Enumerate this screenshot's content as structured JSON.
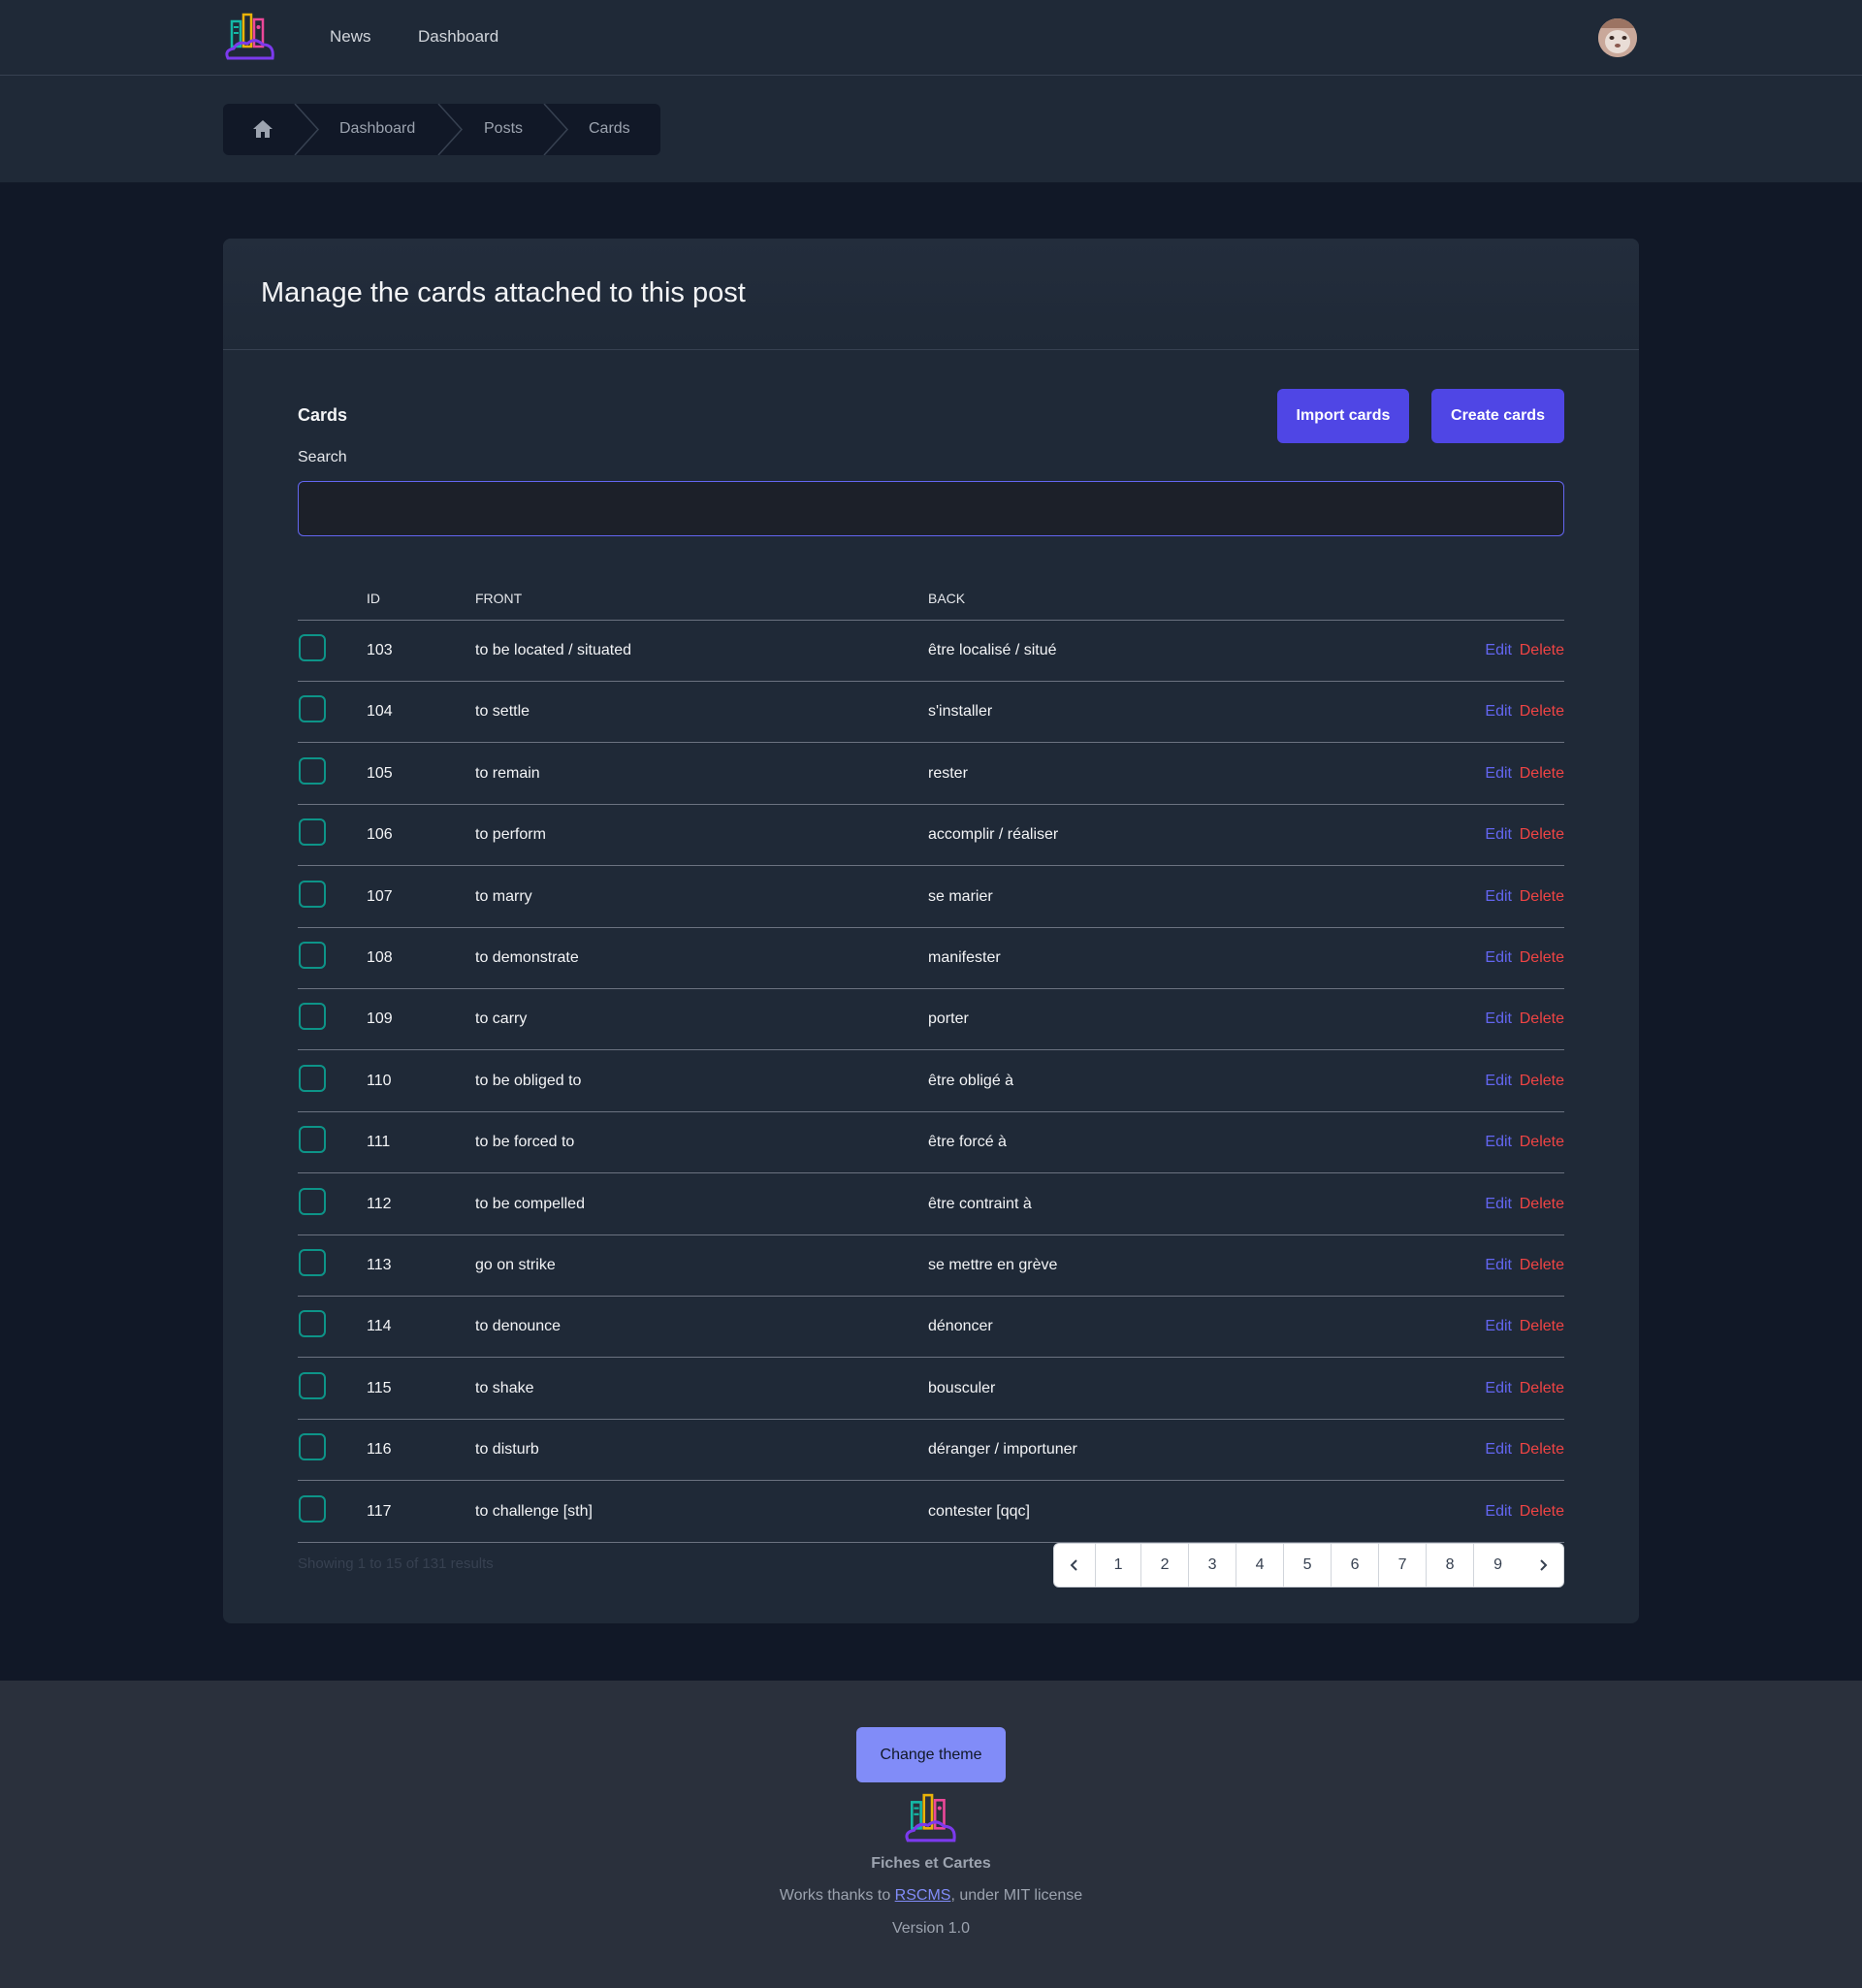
{
  "nav": {
    "links": [
      "News",
      "Dashboard"
    ]
  },
  "breadcrumb": {
    "items": [
      "Dashboard",
      "Posts",
      "Cards"
    ]
  },
  "page": {
    "title": "Manage the cards attached to this post",
    "section_title": "Cards",
    "search_label": "Search",
    "search_value": "",
    "import_label": "Import cards",
    "create_label": "Create cards"
  },
  "table": {
    "headers": [
      "ID",
      "Front",
      "Back"
    ],
    "edit_label": "Edit",
    "delete_label": "Delete",
    "rows": [
      {
        "id": "103",
        "front": "to be located / situated",
        "back": "être localisé / situé"
      },
      {
        "id": "104",
        "front": "to settle",
        "back": "s'installer"
      },
      {
        "id": "105",
        "front": "to remain",
        "back": "rester"
      },
      {
        "id": "106",
        "front": "to perform",
        "back": "accomplir / réaliser"
      },
      {
        "id": "107",
        "front": "to marry",
        "back": "se marier"
      },
      {
        "id": "108",
        "front": "to demonstrate",
        "back": "manifester"
      },
      {
        "id": "109",
        "front": "to carry",
        "back": "porter"
      },
      {
        "id": "110",
        "front": "to be obliged to",
        "back": "être obligé à"
      },
      {
        "id": "111",
        "front": "to be forced to",
        "back": "être forcé à"
      },
      {
        "id": "112",
        "front": "to be compelled",
        "back": "être contraint à"
      },
      {
        "id": "113",
        "front": "go on strike",
        "back": "se mettre en grève"
      },
      {
        "id": "114",
        "front": "to denounce",
        "back": "dénoncer"
      },
      {
        "id": "115",
        "front": "to shake",
        "back": "bousculer"
      },
      {
        "id": "116",
        "front": "to disturb",
        "back": "déranger / importuner"
      },
      {
        "id": "117",
        "front": "to challenge [sth]",
        "back": "contester [qqc]"
      }
    ]
  },
  "pagination": {
    "summary": "Showing 1 to 15 of 131 results",
    "pages": [
      "1",
      "2",
      "3",
      "4",
      "5",
      "6",
      "7",
      "8",
      "9"
    ]
  },
  "footer": {
    "theme_button": "Change theme",
    "brand": "Fiches et Cartes",
    "credit_prefix": "Works thanks to ",
    "credit_link": "RSCMS",
    "credit_suffix": ", under MIT license",
    "version": "Version 1.0"
  },
  "colors": {
    "accent": "#4f46e5",
    "delete": "#ef4444",
    "checkbox_border": "#0d9488"
  },
  "icons": [
    "app-logo-icon",
    "home-icon",
    "chevron-left-icon",
    "chevron-right-icon"
  ]
}
